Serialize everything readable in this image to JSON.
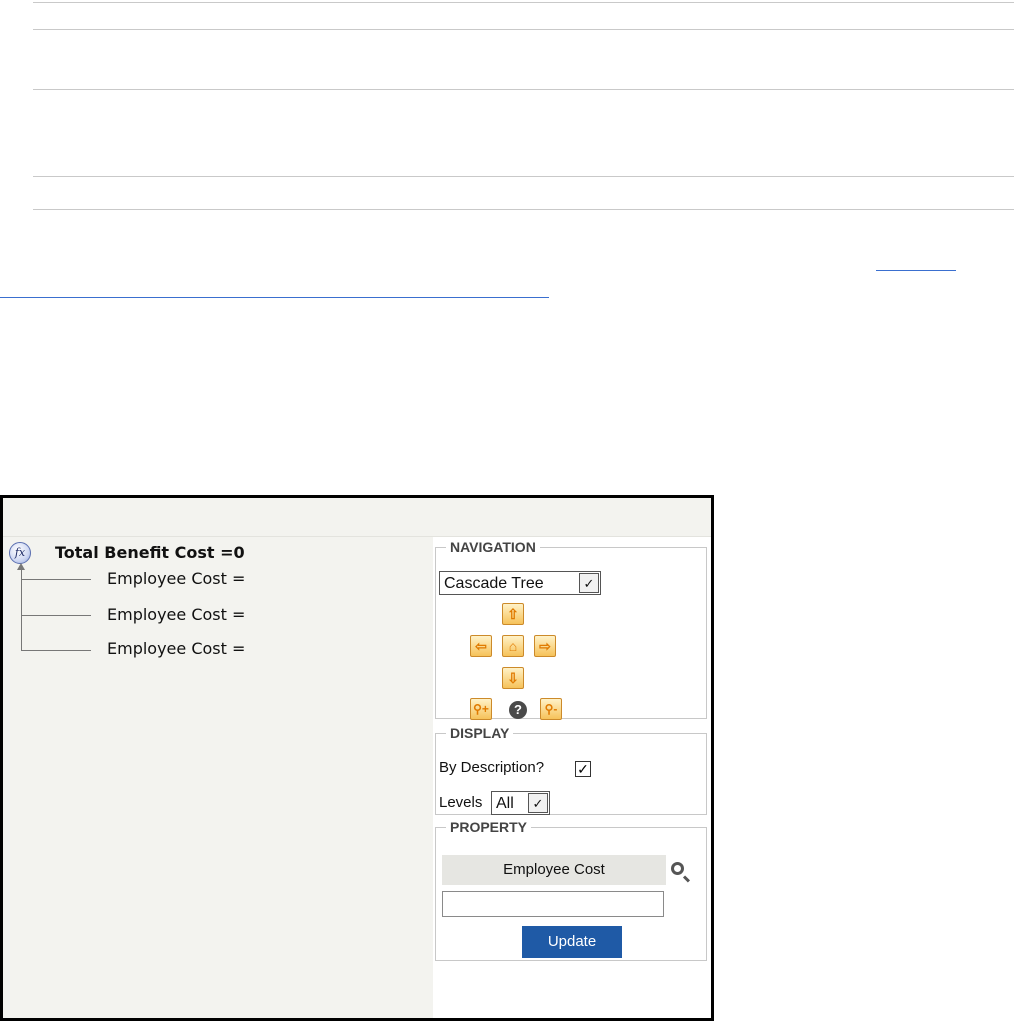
{
  "tree": {
    "root_label": "Total Benefit Cost =0",
    "root_icon": "fx-formula-icon",
    "children": [
      "Employee Cost =",
      "Employee Cost =",
      "Employee Cost ="
    ]
  },
  "navigation": {
    "legend": "NAVIGATION",
    "view_select": "Cascade Tree",
    "buttons": {
      "up": "up-arrow-icon",
      "left": "left-arrow-icon",
      "home": "home-icon",
      "right": "right-arrow-icon",
      "down": "down-arrow-icon",
      "zoom_in": "zoom-in-icon",
      "help": "help-icon",
      "zoom_out": "zoom-out-icon"
    }
  },
  "display": {
    "legend": "DISPLAY",
    "by_description_label": "By Description?",
    "by_description_checked": true,
    "levels_label": "Levels",
    "levels_value": "All"
  },
  "property": {
    "legend": "PROPERTY",
    "name": "Employee Cost",
    "value": "",
    "update_label": "Update"
  },
  "colors": {
    "accent": "#1f5aa6",
    "nav_button": "#f6c25a",
    "link": "#3a6fcf"
  }
}
